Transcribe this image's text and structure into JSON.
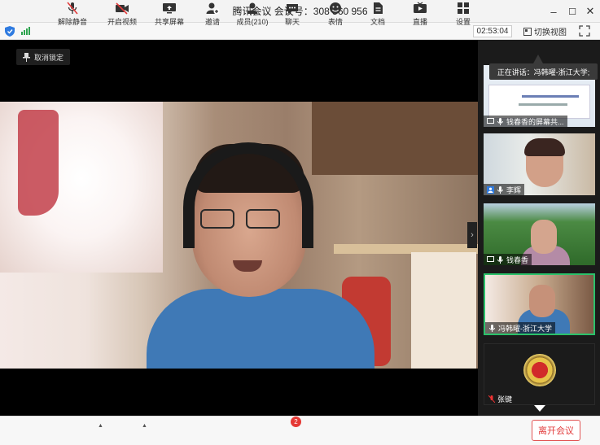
{
  "window": {
    "title": "腾讯会议 会议号：308 560 956",
    "minimize": "–",
    "maximize": "☐",
    "close": "✕"
  },
  "infobar": {
    "timer": "02:53:04",
    "switch_view": "切换视图"
  },
  "main": {
    "unpin_label": "取消锁定",
    "side_arrow": "›"
  },
  "sidebar": {
    "speaking": "正在讲话：冯韩曜-浙江大学;",
    "tiles": [
      {
        "name": "钱春香的屏幕共..."
      },
      {
        "name": "李辉"
      },
      {
        "name": "钱春香"
      },
      {
        "name": "冯韩曜-浙江大学"
      },
      {
        "name": "张键"
      }
    ]
  },
  "toolbar": {
    "unmute": "解除静音",
    "start_video": "开启视频",
    "share_screen": "共享屏幕",
    "invite": "邀请",
    "members": "成员(210)",
    "chat": "聊天",
    "chat_badge": "2",
    "reaction": "表情",
    "docs": "文档",
    "live": "直播",
    "settings": "设置",
    "leave": "离开会议",
    "caret": "▲"
  },
  "colors": {
    "accent_green": "#2bc26b",
    "leave_red": "#e23b3b",
    "badge_red": "#e53935"
  }
}
